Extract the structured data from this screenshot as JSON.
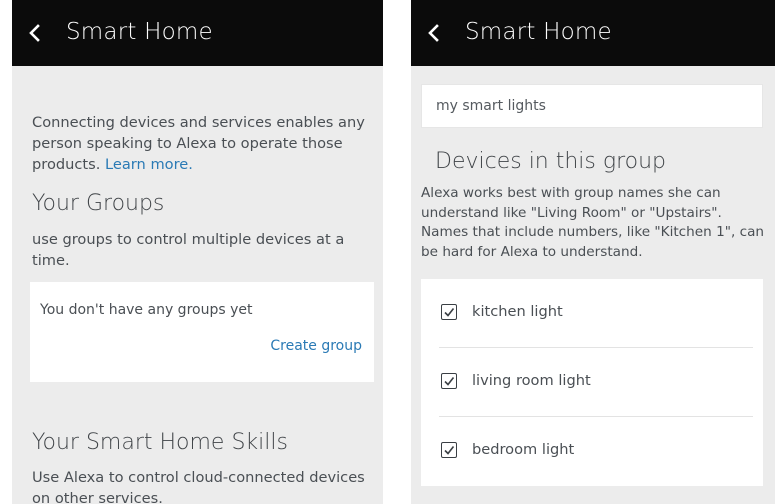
{
  "left_screen": {
    "header": {
      "title": "Smart Home",
      "back_icon": "chevron-left-icon"
    },
    "intro": {
      "text": "Connecting devices and services enables any person speaking to Alexa to operate those products.",
      "link": "Learn more."
    },
    "groups": {
      "heading": "Your Groups",
      "description": "use groups to control multiple devices at a time.",
      "empty_message": "You don't have any groups yet",
      "create_label": "Create group"
    },
    "skills": {
      "heading": "Your Smart Home Skills",
      "description": "Use Alexa to control cloud-connected devices on other services."
    }
  },
  "right_screen": {
    "header": {
      "title": "Smart Home",
      "back_icon": "chevron-left-icon"
    },
    "group_name_input": {
      "value": "my smart lights"
    },
    "devices_section": {
      "heading": "Devices in this group",
      "description": "Alexa works best with group names she can understand like \"Living Room\" or \"Upstairs\". Names that include numbers, like \"Kitchen 1\", can be hard for Alexa to understand."
    },
    "devices": [
      {
        "label": "kitchen light",
        "checked": true
      },
      {
        "label": "living room light",
        "checked": true
      },
      {
        "label": "bedroom light",
        "checked": true
      }
    ]
  },
  "colors": {
    "app_bar": "#0b0b0b",
    "background": "#ececec",
    "card": "#ffffff",
    "link": "#2a7ab5"
  }
}
